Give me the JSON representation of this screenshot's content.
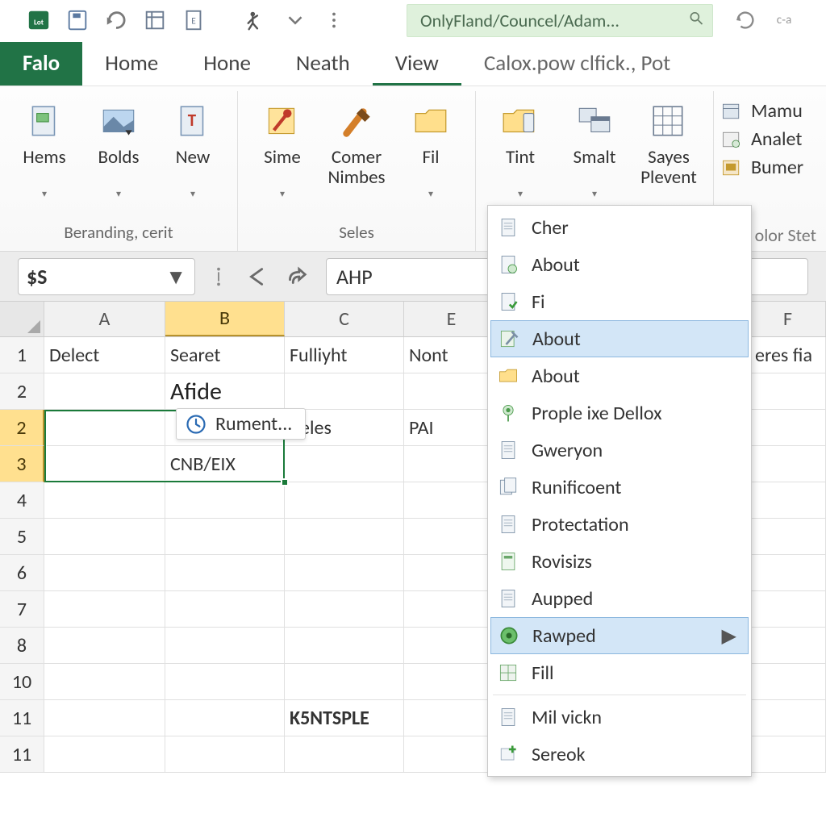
{
  "titlebar": {
    "document_path": "OnlyFland/Councel/Adam..."
  },
  "tabs": [
    {
      "label": "Falo",
      "kind": "file"
    },
    {
      "label": "Home",
      "kind": "normal"
    },
    {
      "label": "Hone",
      "kind": "normal"
    },
    {
      "label": "Neath",
      "kind": "normal"
    },
    {
      "label": "View",
      "kind": "current"
    },
    {
      "label": "Calox.pow clfick., Pot",
      "kind": "truncate"
    }
  ],
  "ribbon": {
    "group1": {
      "name": "Beranding, cerit",
      "buttons": [
        {
          "label": "Hems",
          "dd": true
        },
        {
          "label": "Bolds",
          "dd": true
        },
        {
          "label": "New",
          "dd": true
        }
      ]
    },
    "group2": {
      "name": "Seles",
      "buttons": [
        {
          "label": "Sime",
          "dd": true
        },
        {
          "label": "Comer\nNimbes",
          "dd": false
        },
        {
          "label": "Fil",
          "dd": true
        }
      ]
    },
    "group3": {
      "name": "",
      "buttons": [
        {
          "label": "Tint",
          "dd": true
        },
        {
          "label": "Smalt",
          "dd": true
        },
        {
          "label": "Sayes\nPlevent",
          "dd": false
        }
      ]
    },
    "stack": [
      "Mamu",
      "Analet",
      "Bumer"
    ],
    "covered_group_label": "olor Stet"
  },
  "formula_bar": {
    "namebox": "$S",
    "formula_prefix": "AHP"
  },
  "columns": [
    "A",
    "B",
    "C",
    "E",
    "",
    "",
    "F"
  ],
  "rows": [
    "1",
    "2",
    "2",
    "3",
    "4",
    "5",
    "6",
    "7",
    "8",
    "10",
    "11",
    "11"
  ],
  "cells": {
    "r1": {
      "A": "Delect",
      "B": "Searet",
      "C": "Fulliyht",
      "E": "Nont",
      "F": "eres fia"
    },
    "r2a": {
      "B": "Afide"
    },
    "r2b": {
      "C": "Beles",
      "E": "PAI"
    },
    "r3": {
      "B": "CNB/EIX"
    },
    "r11a": {
      "C": "K5NTSPLE"
    }
  },
  "tooltip": {
    "label": "Rument..."
  },
  "dropdown": {
    "items": [
      {
        "label": "Cher",
        "icon": "doc"
      },
      {
        "label": "About",
        "icon": "doc-green"
      },
      {
        "label": "Fi",
        "icon": "doc-check"
      },
      {
        "label": "About",
        "icon": "tools",
        "hover": true
      },
      {
        "label": "About",
        "icon": "folder"
      },
      {
        "label": "Prople ixe Dellox",
        "icon": "pin"
      },
      {
        "label": "Gweryon",
        "icon": "doc"
      },
      {
        "label": "Runificoent",
        "icon": "docs"
      },
      {
        "label": "Protectation",
        "icon": "doc"
      },
      {
        "label": "Rovisizs",
        "icon": "doc-green2"
      },
      {
        "label": "Aupped",
        "icon": "doc"
      },
      {
        "label": "Rawped",
        "icon": "circle",
        "hover": true,
        "submenu": true
      },
      {
        "label": "Fill",
        "icon": "grid"
      },
      {
        "sep": true
      },
      {
        "label": "Mil vickn",
        "icon": "doc"
      },
      {
        "label": "Sereok",
        "icon": "plus"
      }
    ]
  }
}
